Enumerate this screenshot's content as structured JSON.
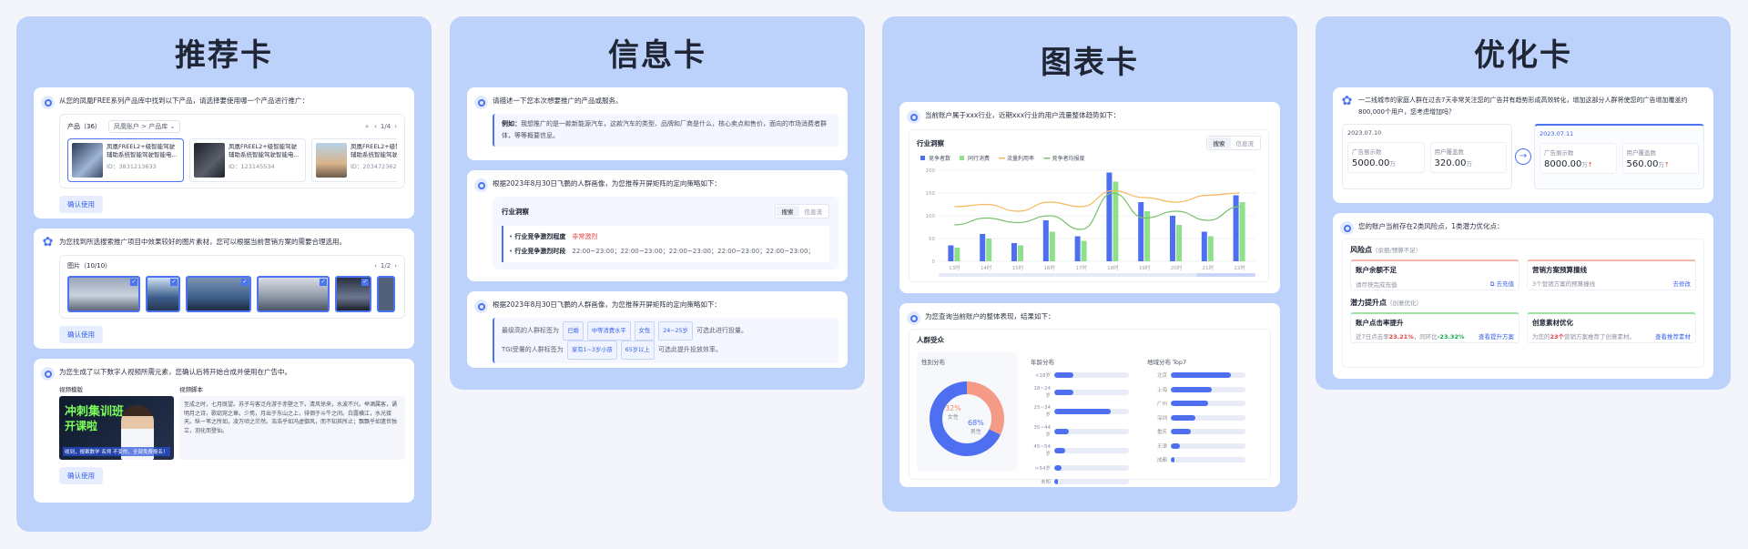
{
  "panels": {
    "recommend": {
      "title": "推荐卡",
      "card1": {
        "message": "从您的凤凰FREE系列产品库中找到以下产品，请选择要使用哪一个产品进行推广：",
        "product_label": "产品（36）",
        "filter": "凤凰账户 > 产品库",
        "pager": "1/4",
        "products": [
          {
            "name": "凤凰FREEL2+级智能驾驶辅助系统智能驾驶智能电...",
            "id": "ID：3831213633"
          },
          {
            "name": "凤凰FREEL2+级智能驾驶辅助系统智能驾驶智能电...",
            "id": "ID：123145534"
          },
          {
            "name": "凤凰FREEL2+级智能驾驶辅助系统智能驾驶智能电...",
            "id": "ID：2034723623"
          }
        ],
        "confirm": "确认使用"
      },
      "card2": {
        "message": "为您找到所选搜索推广项目中效果较好的图片素材，您可以根据当前营销方案的需要合理选用。",
        "image_label": "图片（10/10）",
        "pager": "1/2",
        "confirm": "确认使用"
      },
      "card3": {
        "message": "为您生成了以下数字人视频所需元素，您确认后将开始合成并使用在广告中。",
        "video_label": "视频模版",
        "script_label": "视频脚本",
        "video_banner_1": "冲刺集训班",
        "video_banner_2": "开课啦",
        "video_caption": "收到，报案数学 名师 不变的，全部免费报名！",
        "script": "至成之时，七月既望。苏子与客泛舟游于赤壁之下。清风徐来，水波不兴。举酒属客，诵明月之诗，歌窈窕之章。少焉，月出于东山之上，徘徊于斗牛之间。白露横江，水光接天。纵一苇之所如，凌万顷之茫然。浩浩乎如冯虚御风，而不知其所止；飘飘乎如遗世独立，羽化而登仙。",
        "confirm": "确认使用"
      }
    },
    "info": {
      "title": "信息卡",
      "card1": {
        "message": "请描述一下您本次想要推广的产品或服务。",
        "example_label": "例如：",
        "example": "我想推广的是一款新能源汽车，这款汽车的类型、品牌和厂商是什么，核心卖点和售价，面向的市场消费者群体，等等概要信息。"
      },
      "card2": {
        "message": "根据2023年8月30日飞鹏的人群画像，为您推荐开屏矩阵的定向策略如下：",
        "section": "行业洞察",
        "tabs": [
          "搜索",
          "信息流"
        ],
        "row1_label": "行业竞争激烈程度",
        "row1_value": "非常激烈",
        "row2_label": "行业竞争激烈时段",
        "row2_value": "22:00~23:00；22:00~23:00；22:00~23:00；22:00~23:00；22:00~23:00；"
      },
      "card3": {
        "message": "根据2023年8月30日飞鹏的人群画像，为您推荐开屏矩阵的定向策略如下：",
        "line1_prefix": "最级高的人群标签为",
        "line1_chips": [
          "已婚",
          "中等消费水平",
          "女性",
          "24~25岁"
        ],
        "line1_suffix": "可选此进行投量。",
        "line2_prefix": "TGI受署的人群标签为",
        "line2_chips": [
          "家有1~3岁小孩",
          "65岁以上"
        ],
        "line2_suffix": "可选此提升投放效率。"
      }
    },
    "chart": {
      "title": "图表卡",
      "card1": {
        "message": "当前账户属于xxx行业，近期xxx行业的用户流量整体趋势如下：",
        "section": "行业洞察",
        "tabs": [
          "搜索",
          "信息流"
        ]
      },
      "card2": {
        "message": "为您查询当前账户的整体表现，结果如下：",
        "section": "人群受众",
        "gender_title": "性别分布",
        "female_pct": "32%",
        "female_label": "女性",
        "male_pct": "68%",
        "male_label": "男性",
        "age_title": "年龄分布",
        "region_title": "地域分布 Top7"
      }
    },
    "optimize": {
      "title": "优化卡",
      "card1": {
        "message": "一二线城市的家庭人群在过去7天非常关注您的广告并有趋势形成高效转化，增加这部分人群将使您的广告增加覆盖约800,000个用户，您考虑增加吗？",
        "before_date": "2023.07.10",
        "after_date": "2023.07.11",
        "before": [
          {
            "label": "广告展示数",
            "value": "5000.00",
            "unit": "万"
          },
          {
            "label": "用户覆盖数",
            "value": "320.00",
            "unit": "万"
          }
        ],
        "after": [
          {
            "label": "广告展示数",
            "value": "8000.00",
            "unit": "万"
          },
          {
            "label": "用户覆盖数",
            "value": "560.00",
            "unit": "万"
          }
        ]
      },
      "card2": {
        "message": "您的账户当前存在2类风险点，1类潜力优化点：",
        "risk_title": "风险点",
        "risk_sub": "（余额/预算不足）",
        "risk_items": [
          {
            "title": "账户余额不足",
            "desc": "请尽快完成充值",
            "action": "去充值"
          },
          {
            "title": "营销方案预算撞线",
            "desc": "3个营销方案的预算撞线",
            "action": "去修改"
          }
        ],
        "potential_title": "潜力提升点",
        "potential_sub": "（创意优化）",
        "potential_items": [
          {
            "title": "账户点击率提升",
            "desc_a": "近7日点击率",
            "val_a": "23.21%",
            "desc_b": "，同环比",
            "val_b": "-23.32%",
            "action": "查看提升方案"
          },
          {
            "title": "创意素材优化",
            "desc_a": "为您的",
            "val_a": "23个",
            "desc_b": "营销方案推荐了创意素材。",
            "val_b": "",
            "action": "查看推荐素材"
          }
        ]
      }
    }
  },
  "chart_data": [
    {
      "type": "bar",
      "title": "行业洞察",
      "categories": [
        "13时",
        "14时",
        "15时",
        "16时",
        "17时",
        "18时",
        "19时",
        "20时",
        "21时",
        "22时"
      ],
      "ylim": [
        0,
        200
      ],
      "yticks": [
        0,
        50,
        100,
        150,
        200
      ],
      "legend": [
        "竞争者数",
        "同行消费",
        "流量利用率",
        "竞争者均报度"
      ],
      "series": [
        {
          "name": "竞争者数",
          "kind": "bar",
          "color": "#4d6ff0",
          "values": [
            35,
            60,
            40,
            90,
            55,
            195,
            130,
            100,
            65,
            145
          ]
        },
        {
          "name": "同行消费",
          "kind": "bar",
          "color": "#8ee08a",
          "values": [
            30,
            50,
            35,
            65,
            45,
            175,
            110,
            80,
            55,
            130
          ]
        },
        {
          "name": "流量利用率",
          "kind": "line",
          "color": "#f5b95a",
          "values": [
            120,
            125,
            110,
            130,
            120,
            155,
            140,
            130,
            145,
            150
          ]
        },
        {
          "name": "竞争者均报度",
          "kind": "line",
          "color": "#79c26b",
          "values": [
            80,
            95,
            85,
            100,
            70,
            150,
            95,
            110,
            90,
            120
          ]
        }
      ],
      "grid": true,
      "legend_position": "top-left"
    },
    {
      "type": "pie",
      "title": "性别分布",
      "categories": [
        "女性",
        "男性"
      ],
      "values": [
        32,
        68
      ],
      "colors": [
        "#f49a86",
        "#4d6ff0"
      ]
    },
    {
      "type": "bar",
      "orientation": "horizontal",
      "title": "年龄分布",
      "categories": [
        "<18岁",
        "18~24岁",
        "25~34岁",
        "35~44岁",
        "45~54岁",
        ">54岁",
        "未知"
      ],
      "values": [
        0.25,
        0.25,
        0.75,
        0.2,
        0.15,
        0.1,
        0.05
      ],
      "xlim": [
        0,
        1
      ]
    },
    {
      "type": "bar",
      "orientation": "horizontal",
      "title": "地域分布 Top7",
      "categories": [
        "北京",
        "上海",
        "广州",
        "深圳",
        "重庆",
        "天津",
        "成都"
      ],
      "values": [
        0.8,
        0.55,
        0.5,
        0.33,
        0.27,
        0.12,
        0.05
      ],
      "xlim": [
        0,
        1
      ]
    }
  ]
}
